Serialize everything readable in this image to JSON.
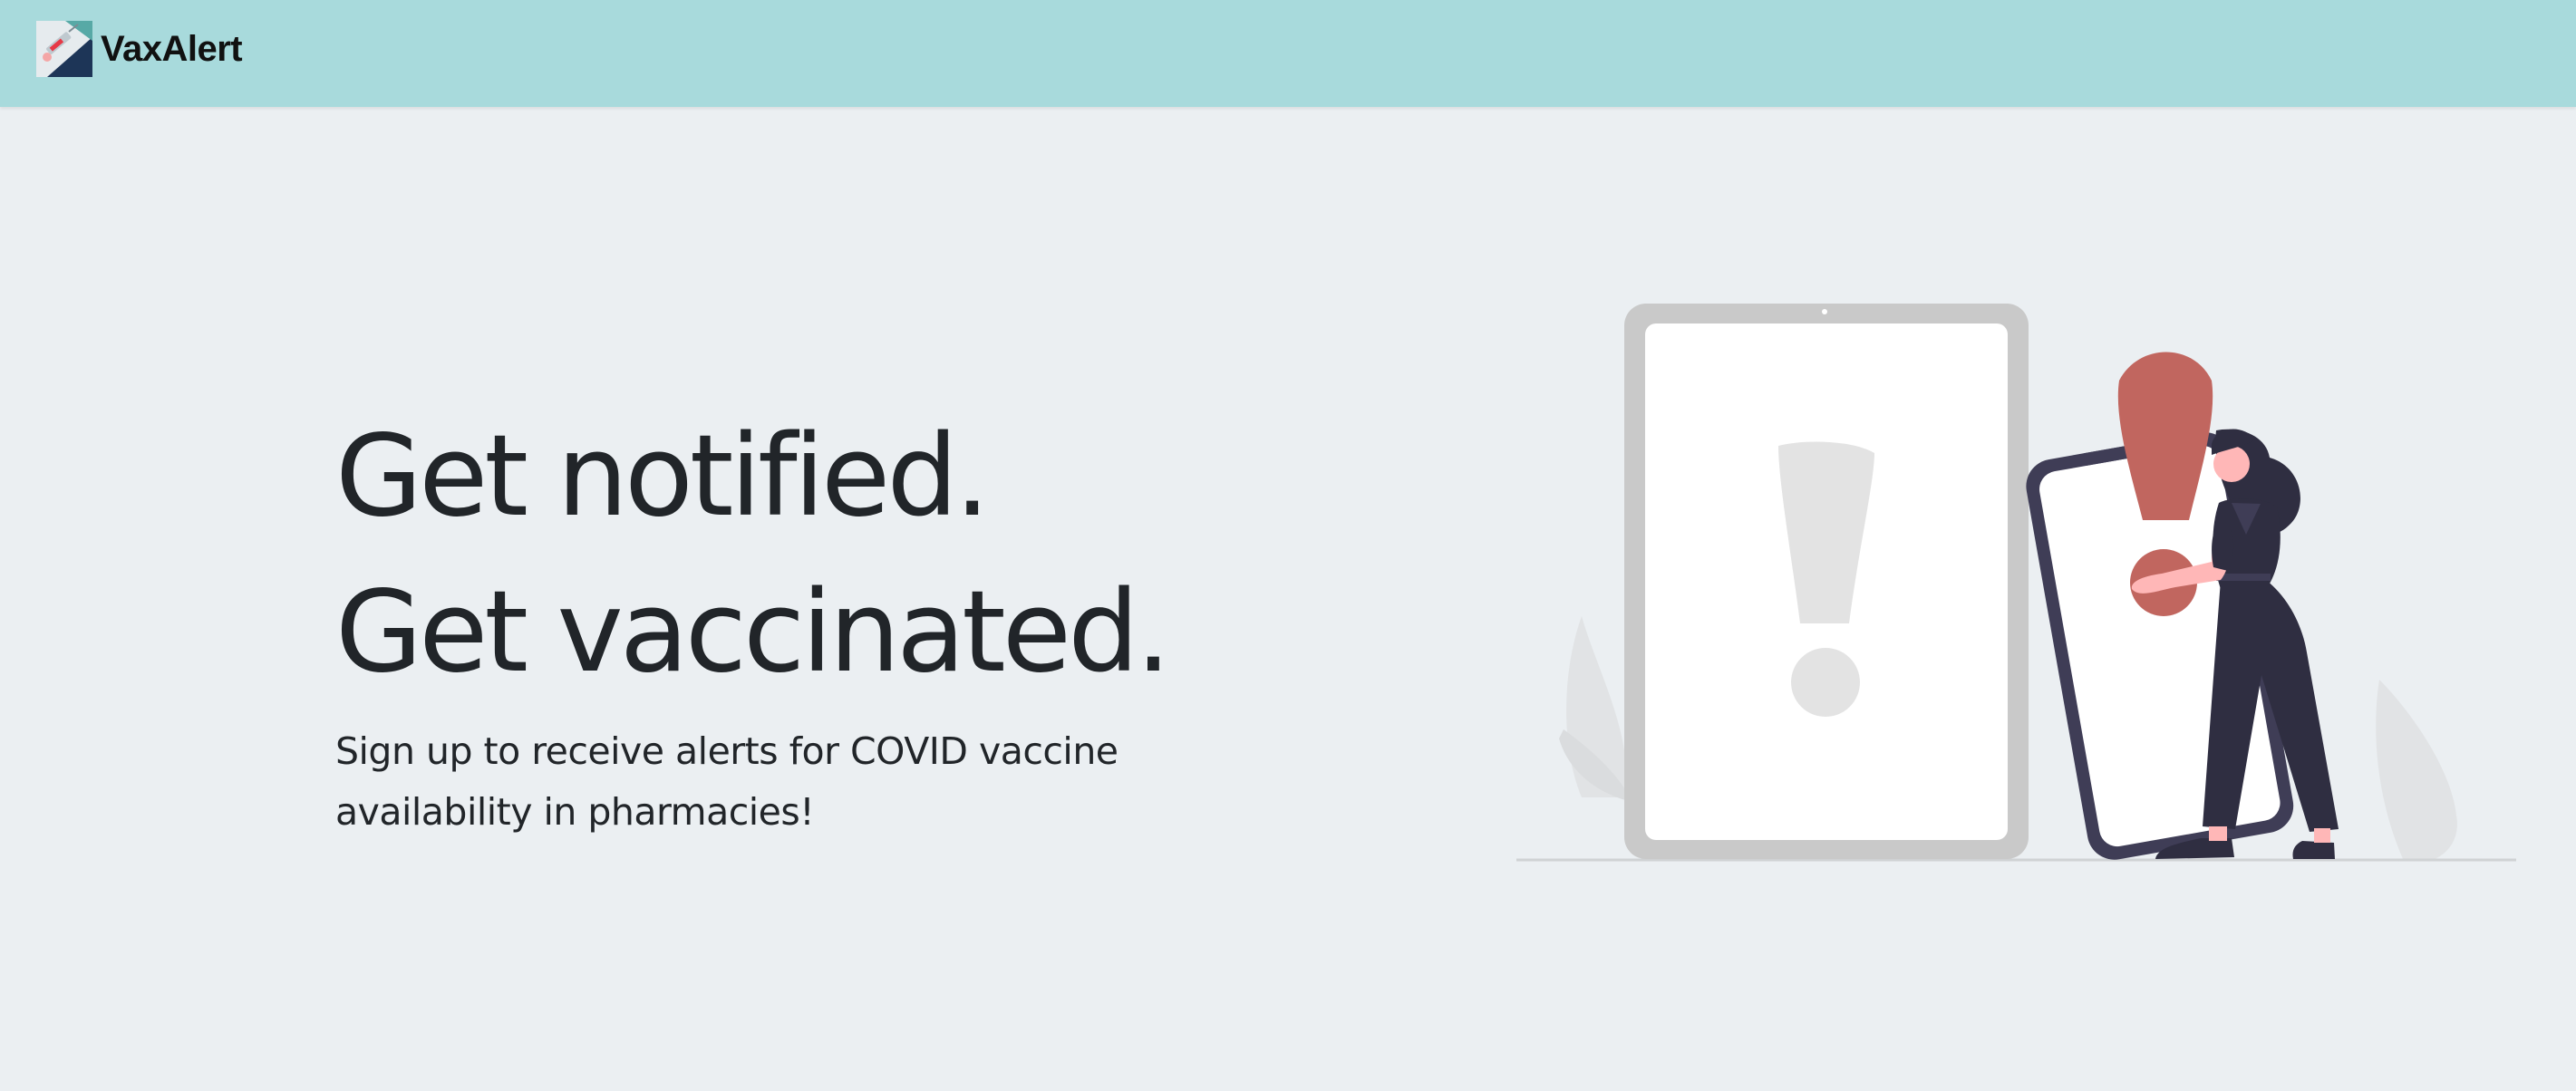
{
  "navbar": {
    "brand_name": "VaxAlert",
    "logo_icon": "vaccine-syringe-logo",
    "background": "#a8dadc"
  },
  "hero": {
    "headline_line1": "Get notified.",
    "headline_line2": "Get vaccinated.",
    "subtext": "Sign up to receive alerts for COVID vaccine availability in pharmacies!",
    "illustration": "woman-with-phone-and-exclamation-mark-illustration"
  },
  "colors": {
    "page_background": "#ebeff2",
    "text_primary": "#212529",
    "accent_red": "#c1665f",
    "figure_dark": "#2f2e41",
    "skin": "#ffb7b7"
  }
}
